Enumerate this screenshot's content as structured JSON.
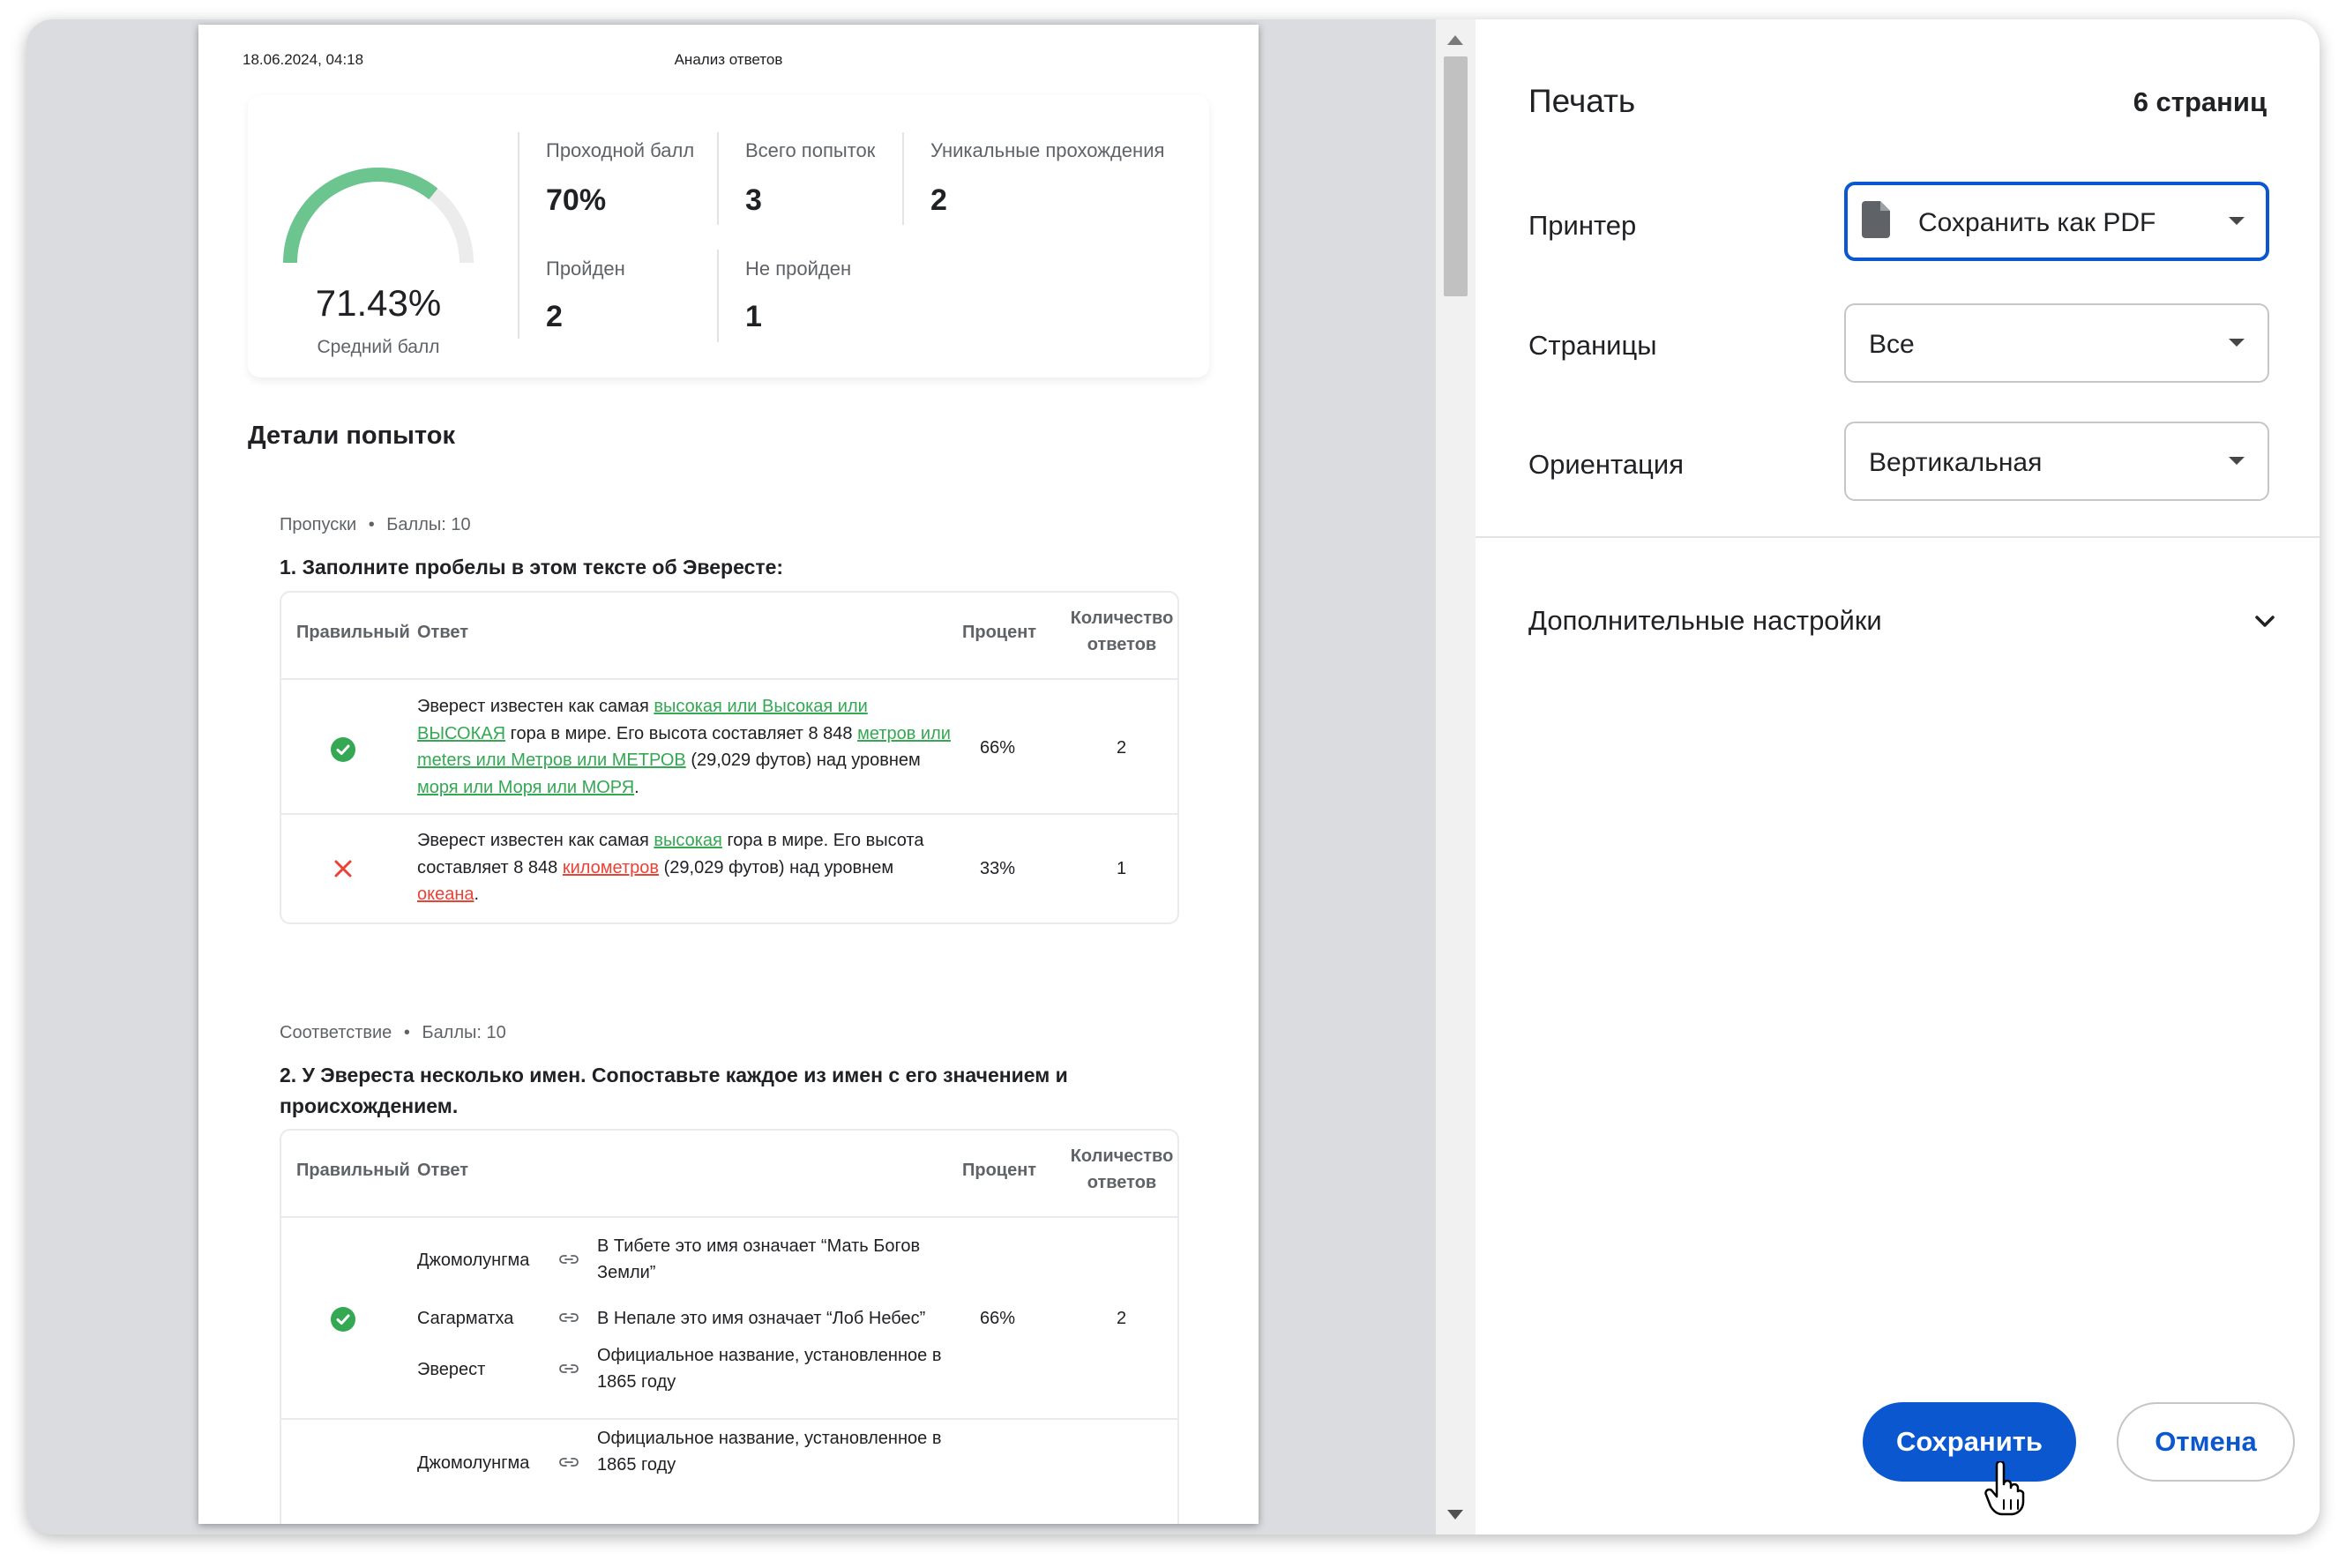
{
  "page_header": {
    "date": "18.06.2024, 04:18",
    "title": "Анализ ответов"
  },
  "summary": {
    "average_score": "71.43%",
    "average_score_fraction": 0.7143,
    "average_score_label": "Средний балл",
    "stats": [
      {
        "label": "Проходной балл",
        "value": "70%"
      },
      {
        "label": "Всего попыток",
        "value": "3"
      },
      {
        "label": "Уникальные прохождения",
        "value": "2"
      },
      {
        "label": "Пройден",
        "value": "2"
      },
      {
        "label": "Не пройден",
        "value": "1"
      }
    ]
  },
  "details_title": "Детали попыток",
  "table_headers": {
    "correct": "Правильный",
    "answer": "Ответ",
    "percent": "Процент",
    "count_line1": "Количество",
    "count_line2": "ответов"
  },
  "questions": [
    {
      "type": "Пропуски",
      "bullet": "•",
      "points": "Баллы: 10",
      "title": "1. Заполните пробелы в этом тексте об Эвересте:",
      "rows": [
        {
          "correct": true,
          "segments": [
            {
              "t": "Эверест известен как самая ",
              "k": "plain"
            },
            {
              "t": "высокая или Высокая или ВЫСОКАЯ",
              "k": "ok"
            },
            {
              "t": " гора в мире. Его высота составляет 8 848 ",
              "k": "plain"
            },
            {
              "t": "метров или meters или Метров или МЕТРОВ",
              "k": "ok"
            },
            {
              "t": " (29,029 футов) над уровнем ",
              "k": "plain"
            },
            {
              "t": "моря или Моря или МОРЯ",
              "k": "ok"
            },
            {
              "t": ".",
              "k": "plain"
            }
          ],
          "percent": "66%",
          "count": "2"
        },
        {
          "correct": false,
          "segments": [
            {
              "t": "Эверест известен как самая ",
              "k": "plain"
            },
            {
              "t": "высокая",
              "k": "ok"
            },
            {
              "t": " гора в мире. Его высота составляет 8 848 ",
              "k": "plain"
            },
            {
              "t": "километров",
              "k": "bad"
            },
            {
              "t": " (29,029 футов) над уровнем ",
              "k": "plain"
            },
            {
              "t": "океана",
              "k": "bad"
            },
            {
              "t": ".",
              "k": "plain"
            }
          ],
          "percent": "33%",
          "count": "1"
        }
      ]
    },
    {
      "type": "Соответствие",
      "bullet": "•",
      "points": "Баллы: 10",
      "title": "2. У Эвереста несколько имен. Сопоставьте каждое из имен с его значением и происхождением.",
      "rows": [
        {
          "correct": true,
          "pairs": [
            {
              "name": "Джомолунгма",
              "meaning": "В Тибете это имя означает “Мать Богов Земли”"
            },
            {
              "name": "Сагарматха",
              "meaning": "В Непале это имя означает “Лоб Небес”"
            },
            {
              "name": "Эверест",
              "meaning": "Официальное название, установленное в 1865 году"
            }
          ],
          "percent": "66%",
          "count": "2"
        },
        {
          "pairs": [
            {
              "name": "Джомолунгма",
              "meaning": "Официальное название, установленное в 1865 году"
            }
          ]
        }
      ]
    }
  ],
  "settings": {
    "title": "Печать",
    "page_count": "6 страниц",
    "printer_label": "Принтер",
    "printer_value": "Сохранить как PDF",
    "pages_label": "Страницы",
    "pages_value": "Все",
    "orientation_label": "Ориентация",
    "orientation_value": "Вертикальная",
    "more_settings": "Дополнительные настройки",
    "save_button": "Сохранить",
    "cancel_button": "Отмена"
  },
  "colors": {
    "accent": "#0b57d0",
    "success": "#34a853",
    "error": "#ea4335"
  }
}
